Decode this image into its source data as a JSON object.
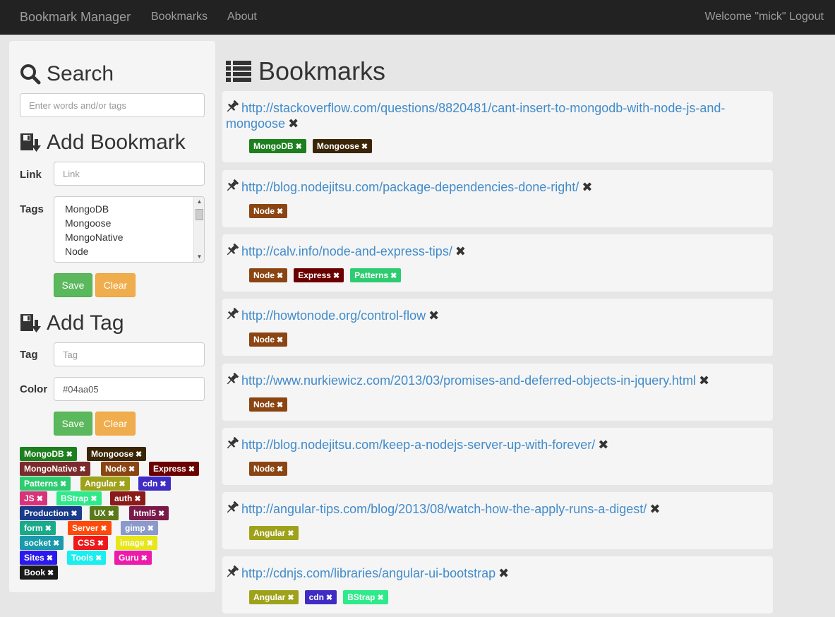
{
  "navbar": {
    "brand": "Bookmark Manager",
    "links": [
      "Bookmarks",
      "About"
    ],
    "welcome": "Welcome \"mick\"",
    "logout": "Logout"
  },
  "search": {
    "title": "Search",
    "placeholder": "Enter words and/or tags"
  },
  "add_bookmark": {
    "title": "Add Bookmark",
    "link_label": "Link",
    "link_placeholder": "Link",
    "tags_label": "Tags",
    "tag_options": [
      "MongoDB",
      "Mongoose",
      "MongoNative",
      "Node"
    ],
    "save": "Save",
    "clear": "Clear"
  },
  "add_tag": {
    "title": "Add Tag",
    "tag_label": "Tag",
    "tag_placeholder": "Tag",
    "color_label": "Color",
    "color_value": "#04aa05",
    "save": "Save",
    "clear": "Clear"
  },
  "tag_cloud": [
    {
      "name": "MongoDB",
      "color": "#1e7f1e"
    },
    {
      "name": "Mongoose",
      "color": "#3b2507"
    },
    {
      "name": "MongoNative",
      "color": "#7b2b2b"
    },
    {
      "name": "Node",
      "color": "#8b4513"
    },
    {
      "name": "Express",
      "color": "#6b0000"
    },
    {
      "name": "Patterns",
      "color": "#2ecc71"
    },
    {
      "name": "Angular",
      "color": "#9ea21b"
    },
    {
      "name": "cdn",
      "color": "#3f2cc4"
    },
    {
      "name": "JS",
      "color": "#d8337a"
    },
    {
      "name": "BStrap",
      "color": "#2eea8a"
    },
    {
      "name": "auth",
      "color": "#8b1a1a"
    },
    {
      "name": "Production",
      "color": "#1a3a8a"
    },
    {
      "name": "UX",
      "color": "#5a7a1a"
    },
    {
      "name": "html5",
      "color": "#7a1a4a"
    },
    {
      "name": "form",
      "color": "#1aaa8a"
    },
    {
      "name": "Server",
      "color": "#ff4a0a"
    },
    {
      "name": "gimp",
      "color": "#8a9aca"
    },
    {
      "name": "socket",
      "color": "#1a9aaa"
    },
    {
      "name": "CSS",
      "color": "#ee1a1a"
    },
    {
      "name": "image",
      "color": "#e6e61a"
    },
    {
      "name": "Sites",
      "color": "#2a1aee"
    },
    {
      "name": "Tools",
      "color": "#1aeeee"
    },
    {
      "name": "Guru",
      "color": "#ee1aaa"
    },
    {
      "name": "Book",
      "color": "#1a1a1a"
    }
  ],
  "main": {
    "title": "Bookmarks",
    "bookmarks": [
      {
        "url": "http://stackoverflow.com/questions/8820481/cant-insert-to-mongodb-with-node-js-and-mongoose",
        "tags": [
          {
            "name": "MongoDB",
            "color": "#1e7f1e"
          },
          {
            "name": "Mongoose",
            "color": "#3b2507"
          }
        ]
      },
      {
        "url": "http://blog.nodejitsu.com/package-dependencies-done-right/",
        "tags": [
          {
            "name": "Node",
            "color": "#8b4513"
          }
        ]
      },
      {
        "url": "http://calv.info/node-and-express-tips/",
        "tags": [
          {
            "name": "Node",
            "color": "#8b4513"
          },
          {
            "name": "Express",
            "color": "#6b0000"
          },
          {
            "name": "Patterns",
            "color": "#2ecc71"
          }
        ]
      },
      {
        "url": "http://howtonode.org/control-flow",
        "tags": [
          {
            "name": "Node",
            "color": "#8b4513"
          }
        ]
      },
      {
        "url": "http://www.nurkiewicz.com/2013/03/promises-and-deferred-objects-in-jquery.html",
        "tags": [
          {
            "name": "Node",
            "color": "#8b4513"
          }
        ]
      },
      {
        "url": "http://blog.nodejitsu.com/keep-a-nodejs-server-up-with-forever/",
        "tags": [
          {
            "name": "Node",
            "color": "#8b4513"
          }
        ]
      },
      {
        "url": "http://angular-tips.com/blog/2013/08/watch-how-the-apply-runs-a-digest/",
        "tags": [
          {
            "name": "Angular",
            "color": "#9ea21b"
          }
        ]
      },
      {
        "url": "http://cdnjs.com/libraries/angular-ui-bootstrap",
        "tags": [
          {
            "name": "Angular",
            "color": "#9ea21b"
          },
          {
            "name": "cdn",
            "color": "#3f2cc4"
          },
          {
            "name": "BStrap",
            "color": "#2eea8a"
          }
        ]
      }
    ]
  }
}
